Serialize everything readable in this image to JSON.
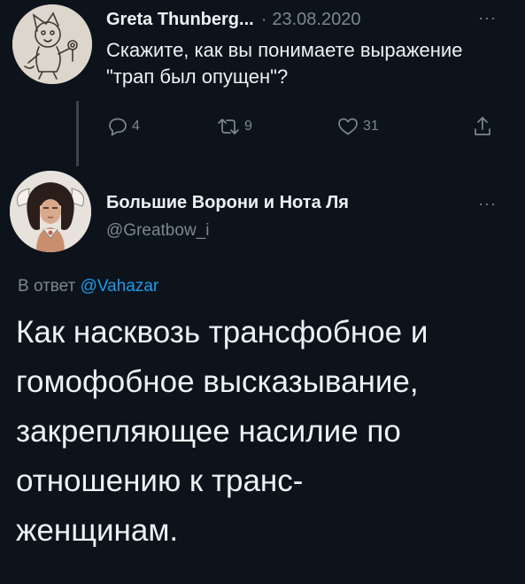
{
  "parent_tweet": {
    "author_name": "Greta Thunberg...",
    "separator": "·",
    "date": "23.08.2020",
    "more_label": "···",
    "text": "Скажите, как вы понимаете выражение \"трап был опущен\"?",
    "actions": {
      "reply_count": "4",
      "retweet_count": "9",
      "like_count": "31"
    }
  },
  "reply_tweet": {
    "author_name": "Большие Ворони и Нота Ля",
    "author_handle": "@Greatbow_i",
    "more_label": "···",
    "reply_prefix": "В ответ",
    "reply_mention": "@Vahazar",
    "text_lines": [
      "Как насквозь трансфобное и",
      "гомофобное высказывание,",
      "закрепляющее насилие по",
      "отношению к транс-",
      "женщинам."
    ]
  },
  "colors": {
    "background": "#0c131b",
    "primary_text": "#eef1f3",
    "secondary_text": "#7c8791",
    "link": "#1d9bf0"
  },
  "icons": {
    "reply": "comment-icon",
    "retweet": "retweet-icon",
    "like": "heart-icon",
    "share": "share-icon"
  }
}
